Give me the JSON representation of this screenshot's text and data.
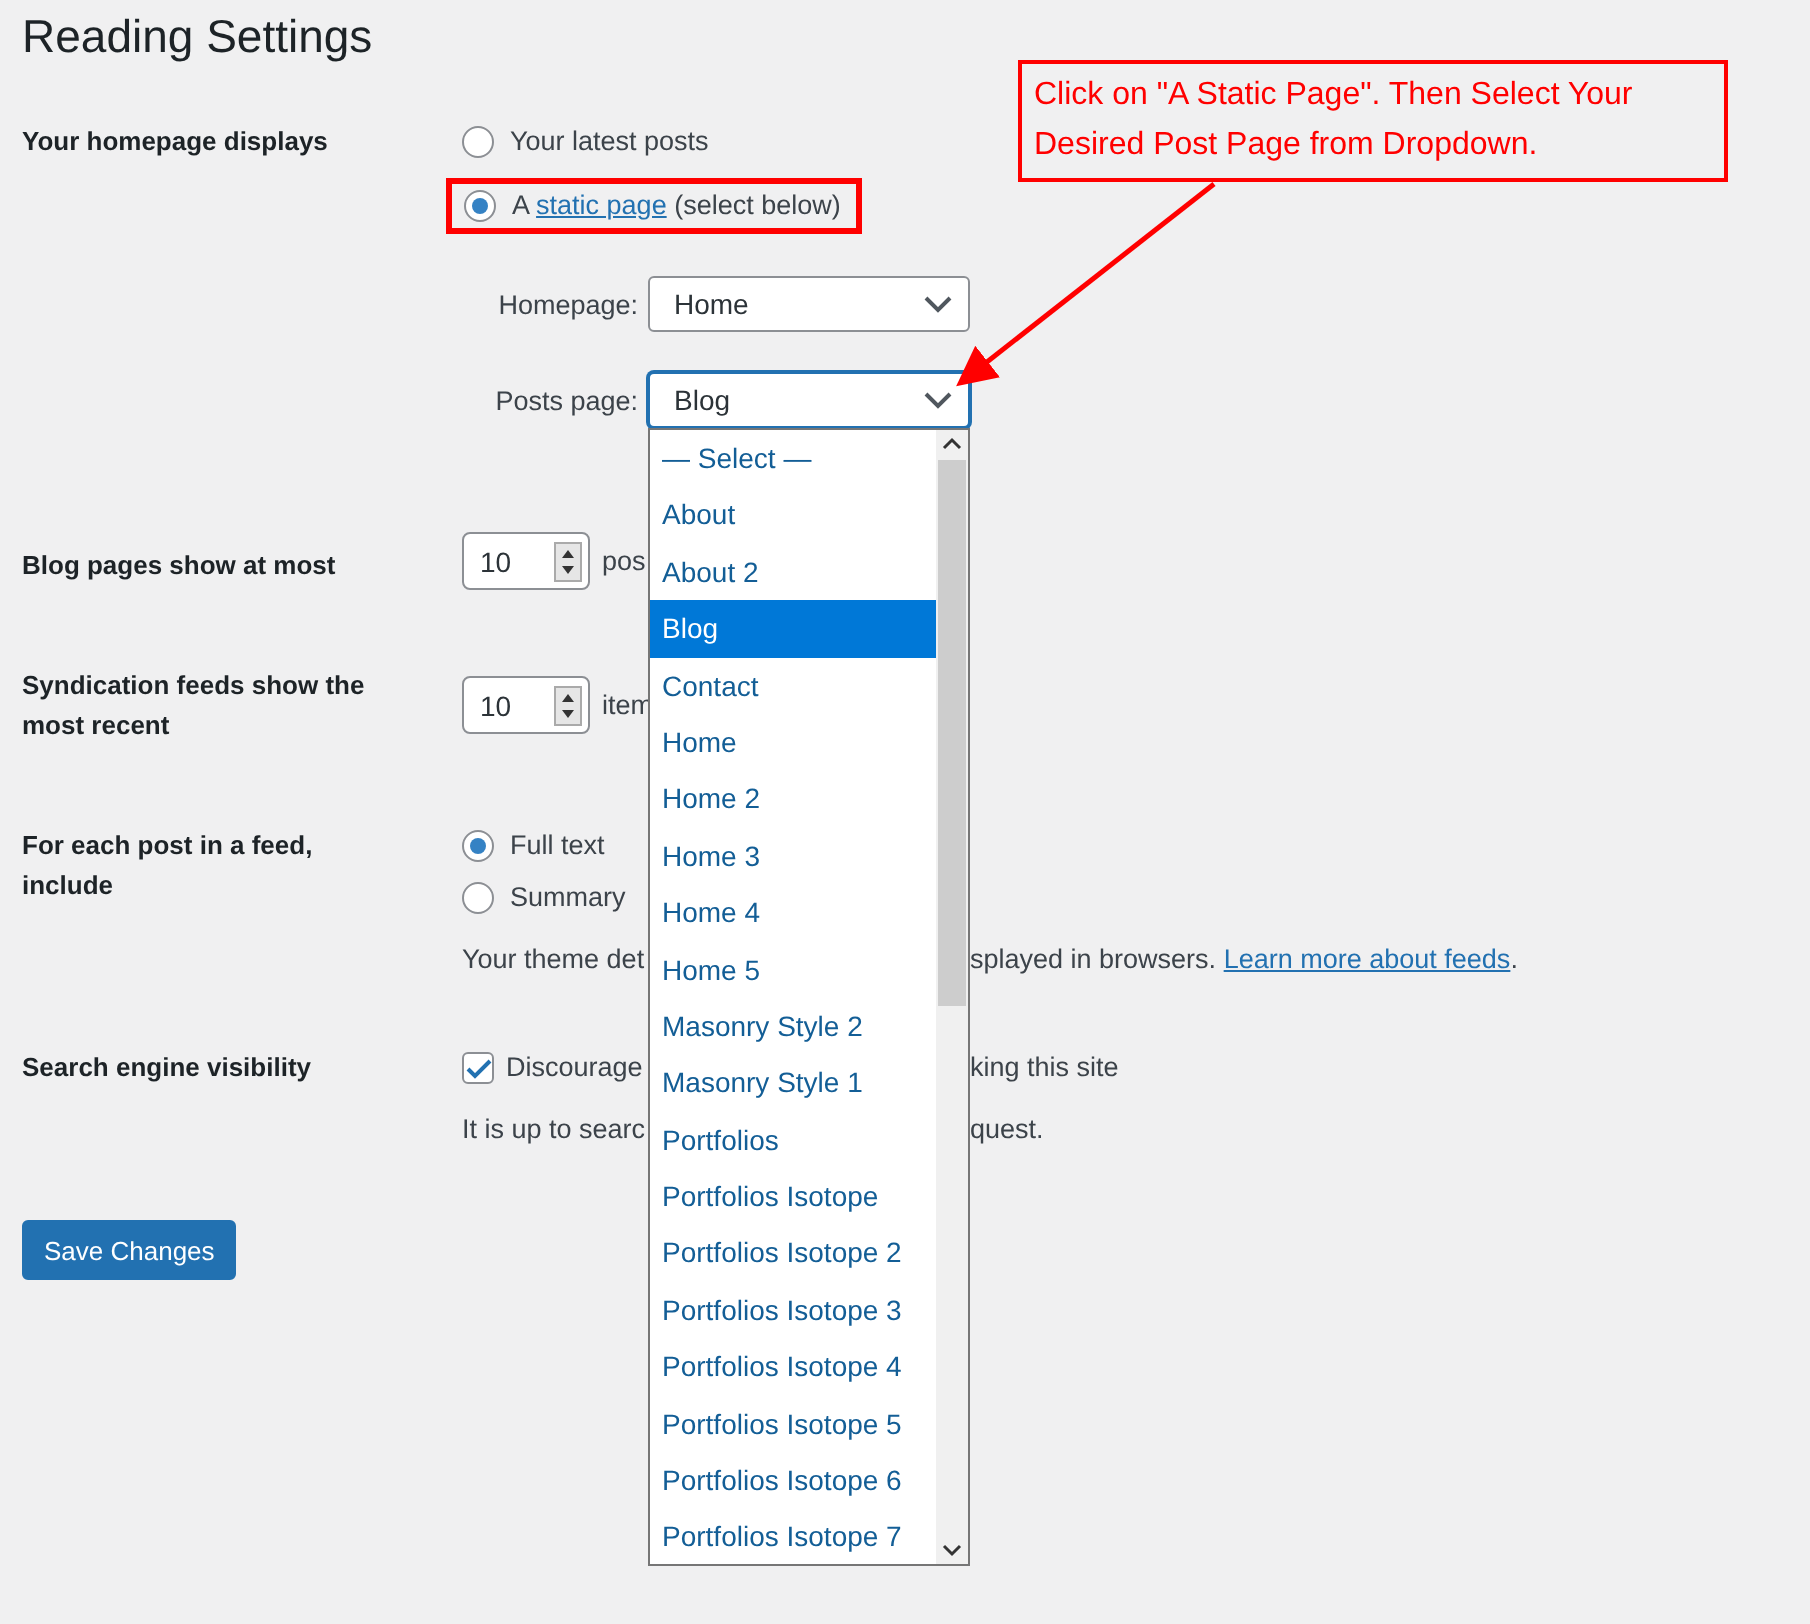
{
  "page_title": "Reading Settings",
  "annotation": {
    "text": "Click on \"A Static Page\". Then Select Your Desired Post Page from Dropdown."
  },
  "homepage_displays": {
    "label": "Your homepage displays",
    "options": [
      {
        "label": "Your latest posts",
        "selected": false,
        "highlighted": false
      },
      {
        "label": "A",
        "link": "static page",
        "suffix": "(select below)",
        "selected": true,
        "highlighted": true
      }
    ],
    "homepage": {
      "label": "Homepage:",
      "value": "Home"
    },
    "posts_page": {
      "label": "Posts page:",
      "value": "Blog",
      "expanded": true
    }
  },
  "dropdown": {
    "options": [
      {
        "label": "— Select —",
        "selected": false
      },
      {
        "label": "About",
        "selected": false
      },
      {
        "label": "About 2",
        "selected": false
      },
      {
        "label": "Blog",
        "selected": true
      },
      {
        "label": "Contact",
        "selected": false
      },
      {
        "label": "Home",
        "selected": false
      },
      {
        "label": "Home 2",
        "selected": false
      },
      {
        "label": "Home 3",
        "selected": false
      },
      {
        "label": "Home 4",
        "selected": false
      },
      {
        "label": "Home 5",
        "selected": false
      },
      {
        "label": "Masonry Style 2",
        "selected": false
      },
      {
        "label": "Masonry Style 1",
        "selected": false
      },
      {
        "label": "Portfolios",
        "selected": false
      },
      {
        "label": "Portfolios Isotope",
        "selected": false
      },
      {
        "label": "Portfolios Isotope 2",
        "selected": false
      },
      {
        "label": "Portfolios Isotope 3",
        "selected": false
      },
      {
        "label": "Portfolios Isotope 4",
        "selected": false
      },
      {
        "label": "Portfolios Isotope 5",
        "selected": false
      },
      {
        "label": "Portfolios Isotope 6",
        "selected": false
      },
      {
        "label": "Portfolios Isotope 7",
        "selected": false
      }
    ]
  },
  "blog_pages": {
    "label": "Blog pages show at most",
    "value": "10",
    "unit": "pos"
  },
  "syndication": {
    "label": "Syndication feeds show the most recent",
    "value": "10",
    "unit": "item"
  },
  "feed_content": {
    "label": "For each post in a feed, include",
    "options": [
      {
        "label": "Full text",
        "selected": true
      },
      {
        "label": "Summary",
        "selected": false
      }
    ],
    "note_start": "Your theme det",
    "note_end": "splayed in browsers.",
    "link": "Learn more about feeds",
    "after_link": "."
  },
  "search_visibility": {
    "label": "Search engine visibility",
    "checkbox_start": "Discourage",
    "checkbox_end": "king this site",
    "checked": true,
    "note_start": "It is up to searc",
    "note_end": "quest."
  },
  "save_button": "Save Changes"
}
